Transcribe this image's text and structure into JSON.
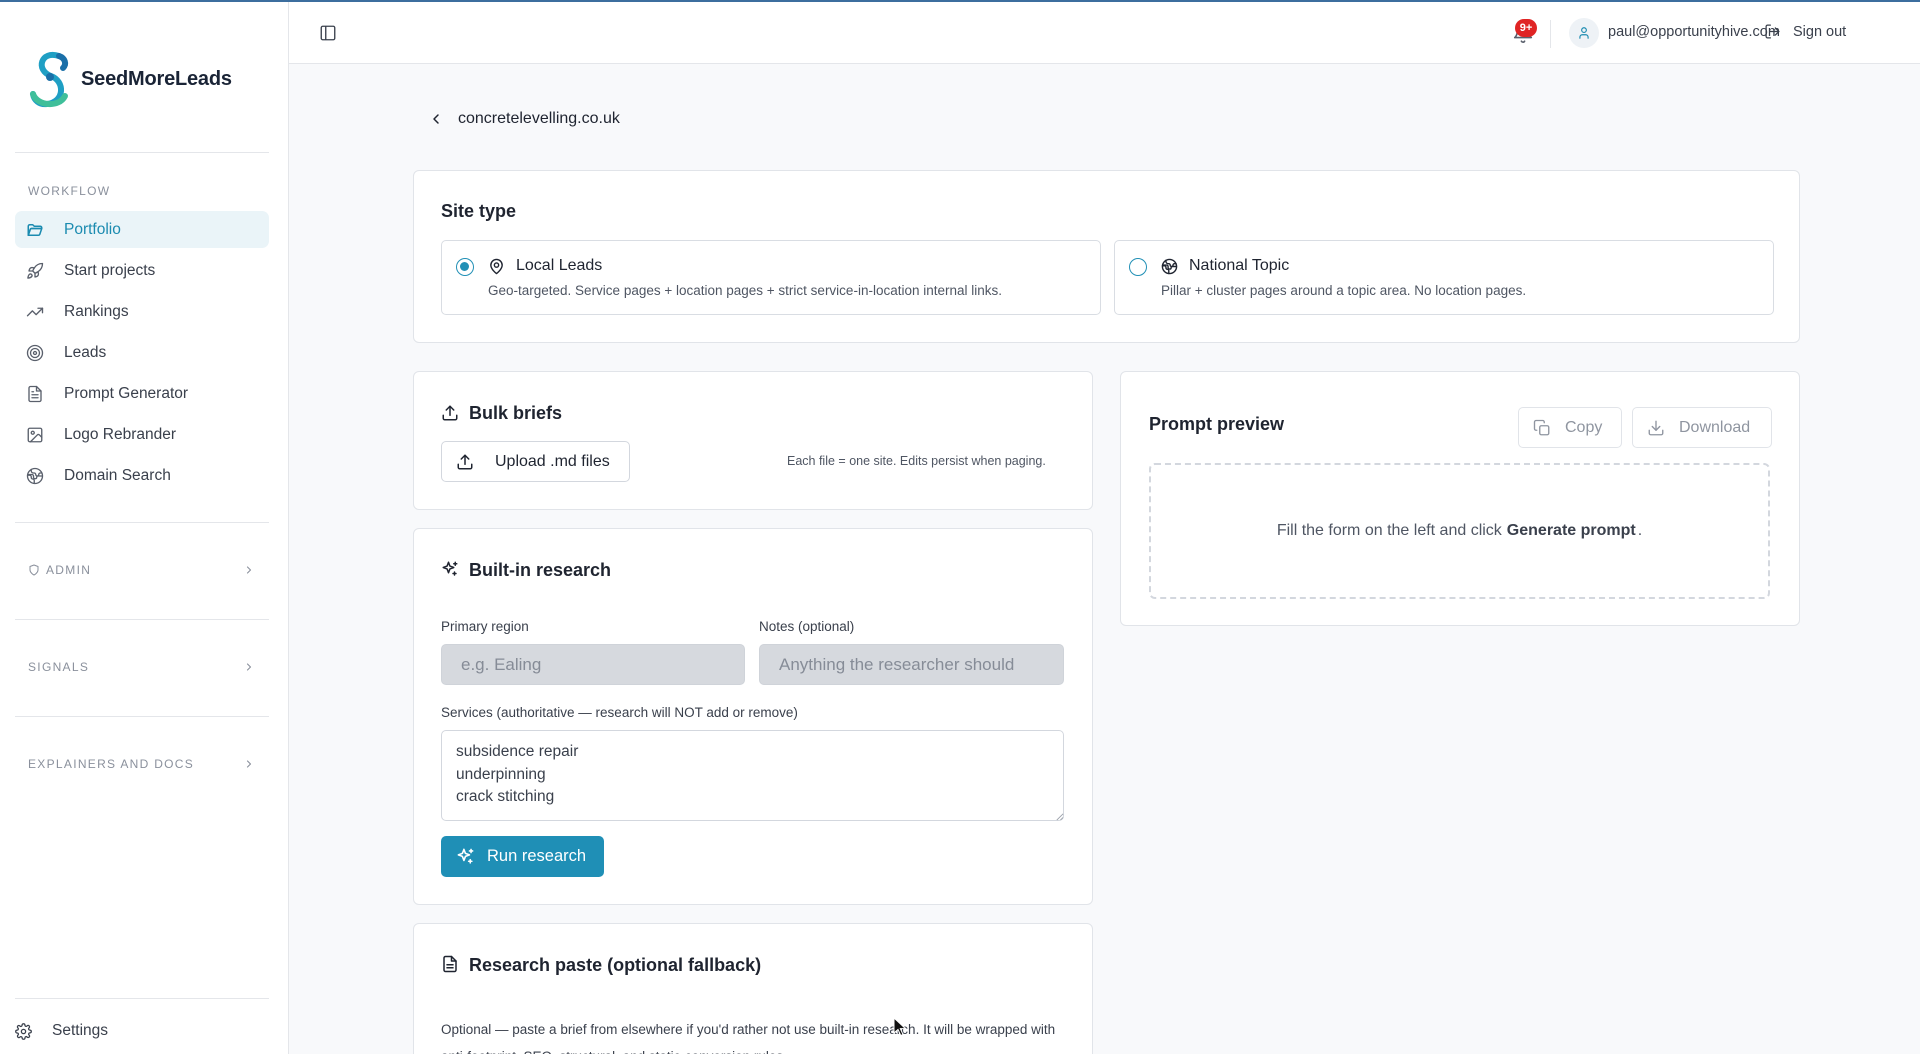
{
  "brand": {
    "name": "SeedMoreLeads"
  },
  "sidebar": {
    "workflow_label": "WORKFLOW",
    "items": [
      {
        "label": "Portfolio",
        "icon": "folder-icon",
        "active": true
      },
      {
        "label": "Start projects",
        "icon": "rocket-icon"
      },
      {
        "label": "Rankings",
        "icon": "trending-up-icon"
      },
      {
        "label": "Leads",
        "icon": "target-icon"
      },
      {
        "label": "Prompt Generator",
        "icon": "file-text-icon"
      },
      {
        "label": "Logo Rebrander",
        "icon": "image-icon"
      },
      {
        "label": "Domain Search",
        "icon": "globe-icon"
      }
    ],
    "admin_label": "ADMIN",
    "signals_label": "SIGNALS",
    "docs_label": "EXPLAINERS AND DOCS",
    "settings_label": "Settings"
  },
  "header": {
    "notifications_badge": "9+",
    "user_email": "paul@opportunityhive.com",
    "sign_out_label": "Sign out"
  },
  "breadcrumb": {
    "title": "concretelevelling.co.uk"
  },
  "site_type": {
    "title": "Site type",
    "options": [
      {
        "title": "Local Leads",
        "description": "Geo-targeted. Service pages + location pages + strict service-in-location internal links.",
        "selected": true
      },
      {
        "title": "National Topic",
        "description": "Pillar + cluster pages around a topic area. No location pages.",
        "selected": false
      }
    ]
  },
  "bulk": {
    "title": "Bulk briefs",
    "upload_label": "Upload .md files",
    "hint": "Each file = one site. Edits persist when paging."
  },
  "research": {
    "title": "Built-in research",
    "region_label": "Primary region",
    "region_placeholder": "e.g. Ealing",
    "notes_label": "Notes (optional)",
    "notes_placeholder": "Anything the researcher should",
    "services_label": "Services (authoritative — research will NOT add or remove)",
    "services_value": "subsidence repair\nunderpinning\ncrack stitching",
    "run_label": "Run research"
  },
  "paste": {
    "title": "Research paste (optional fallback)",
    "description": "Optional — paste a brief from elsewhere if you'd rather not use built-in research. It will be wrapped with anti-footprint, SEO, structural, and static-conversion rules."
  },
  "preview": {
    "title": "Prompt preview",
    "copy_label": "Copy",
    "download_label": "Download",
    "empty_prefix": "Fill the form on the left and click",
    "empty_action": "Generate prompt",
    "empty_suffix": "."
  },
  "colors": {
    "accent": "#1f8fb6",
    "active_bg": "#eaf4f8",
    "badge": "#e02424"
  }
}
